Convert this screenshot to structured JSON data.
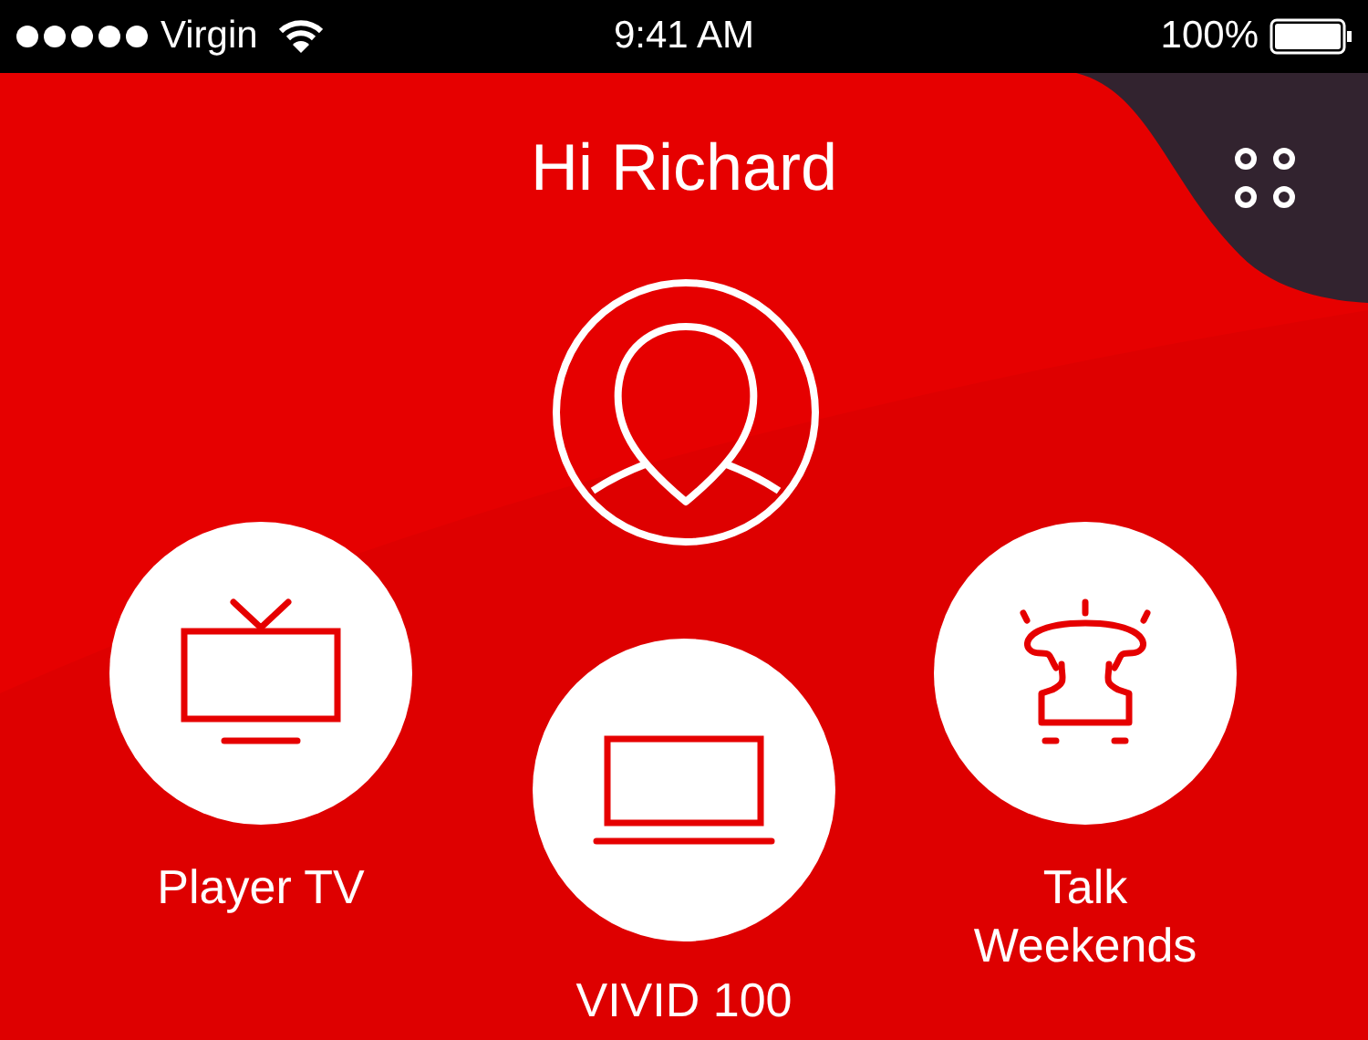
{
  "status_bar": {
    "carrier": "Virgin",
    "time": "9:41 AM",
    "battery": "100%"
  },
  "greeting": "Hi Richard",
  "tiles": [
    {
      "kind": "tv",
      "label": "Player TV"
    },
    {
      "kind": "laptop",
      "label": "VIVID 100"
    },
    {
      "kind": "phone",
      "label": "Talk Weekends"
    }
  ]
}
